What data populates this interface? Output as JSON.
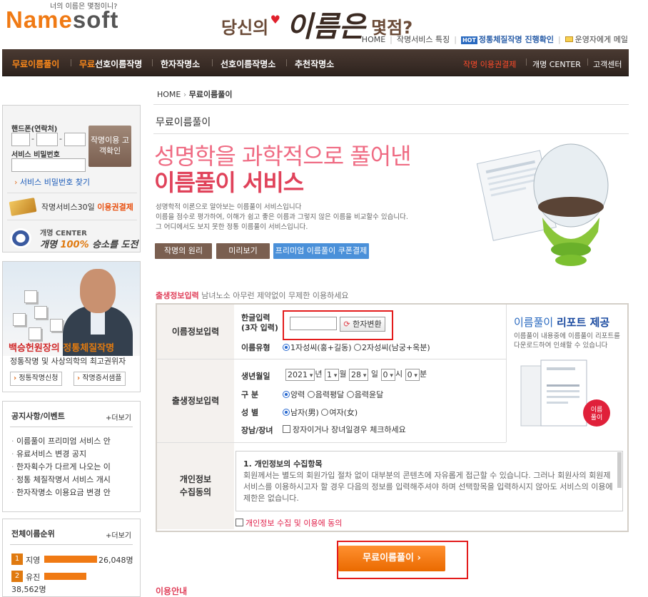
{
  "header": {
    "logo_text_1": "Name",
    "logo_text_2": "soft",
    "tagline": "너의 이름은 몇점이니?",
    "slogan_pre": "당신의",
    "slogan_big": "이름은",
    "slogan_post": "몇점?",
    "links": [
      {
        "label": "HOME"
      },
      {
        "label": "작명서비스 특징"
      },
      {
        "label": "정통체질작명 진행확인",
        "badge": "HOT"
      },
      {
        "label": "운영자에게 메일"
      }
    ]
  },
  "nav": {
    "items": [
      {
        "label": "무료이름풀이"
      },
      {
        "label": "무료선호이름작명"
      },
      {
        "label": "한자작명소"
      },
      {
        "label": "선호이름작명소"
      },
      {
        "label": "추천작명소"
      }
    ],
    "right": [
      {
        "label": "작명 이용권결제"
      },
      {
        "label": "개명 CENTER"
      },
      {
        "label": "고객센터"
      }
    ]
  },
  "login": {
    "phone_label": "핸드폰(연락처)",
    "pw_label": "서비스 비밀번호",
    "confirm_label": "작명이용 고객확인",
    "find_pw": "서비스 비밀번호 찾기",
    "pay30_pre": "작명서비스30일",
    "pay30_em": "이용권결제",
    "center_t1": "개명 CENTER",
    "center_t2_pre": "개명",
    "center_t2_em": "100%",
    "center_t2_post": "승소를 도전"
  },
  "promo": {
    "title_pre": "백승헌원장의",
    "title_em": "정통체질작명",
    "subtitle": "정통작명 및 사상의학의 최고권위자",
    "btn1": "정통작명신청",
    "btn2": "작명증서샘플"
  },
  "notice": {
    "title": "공지사항/이벤트",
    "more": "+더보기",
    "items": [
      "이름풀이 프리미엄 서비스 안",
      "유료서비스 변경 공지",
      "한자획수가 다르게 나오는 이",
      "정통 체질작명서 서비스 개시",
      "한자작명소 이용요금 변경 안"
    ]
  },
  "rank": {
    "title": "전체이름순위",
    "more": "+더보기",
    "items": [
      {
        "rank": "1",
        "name": "지영",
        "count": "26,048명",
        "ratio": 1.0
      },
      {
        "rank": "2",
        "name": "유진",
        "count": "38,562명",
        "ratio": 0.8
      }
    ]
  },
  "content": {
    "breadcrumb_home": "HOME",
    "breadcrumb_current": "무료이름풀이",
    "section_title": "무료이름풀이",
    "hero_line1": "성명학을 과학적으로 풀어낸",
    "hero_line2": "이름풀이 서비스",
    "desc": [
      "성명학적 이론으로 알아보는 이름풀이 서비스입니다",
      "이름을 점수로 평가하여, 이해가 쉽고 좋은 이름과 그렇지 않은 이름을 비교할수 있습니다.",
      "그 어디에서도 보지 못한 정통 이름풀이 서비스입니다."
    ],
    "buttons": [
      "작명의 원리",
      "미리보기",
      "프리미엄 이름풀이 쿠폰결제"
    ],
    "form_head_title": "출생정보입력",
    "form_head_sub": "남녀노소 아무런 제약없이 무제한 이용하세요"
  },
  "form": {
    "row1_label": "이름정보입력",
    "row2_label": "출생정보입력",
    "row3_label_1": "개인정보",
    "row3_label_2": "수집동의",
    "hangul_label_1": "한글입력",
    "hangul_label_2": "(3자 입력)",
    "hangul_value": "",
    "hanja_btn": "한자변환",
    "name_type_label": "이름유형",
    "name_type_opt1": "1자성씨(홍+길동)",
    "name_type_opt2": "2자성씨(남궁+옥분)",
    "birth_label": "생년월일",
    "year": "2021",
    "year_unit": "년",
    "month": "1",
    "month_unit": "월",
    "day": "28",
    "day_unit": "일",
    "hour": "0",
    "hour_unit": "시",
    "minute": "0",
    "minute_unit": "분",
    "calendar_label": "구 분",
    "cal_opt1": "양력",
    "cal_opt2": "음력평달",
    "cal_opt3": "음력윤달",
    "gender_label": "성 별",
    "gender_opt1": "남자(男)",
    "gender_opt2": "여자(女)",
    "eldest_label": "장남/장녀",
    "eldest_text": "장자이거나 장녀일경우 체크하세요",
    "report_title_pre": "이름풀이",
    "report_title_em": "리포트 제공",
    "report_desc_1": "이름풀이 내용중에 이름풀이 리포트를",
    "report_desc_2": "다운로드하여 인쇄할 수 있습니다",
    "consent_heading": "1. 개인정보의 수집항목",
    "consent_body": "회원께서는 별도의 회원가입 절차 없이 대부분의 콘텐츠에 자유롭게 접근할 수 있습니다. 그러나 회원사의 회원제 서비스를 이용하시고자 할 경우 다음의 정보를 입력해주셔야 하며 선택항목을 입력하시지 않아도 서비스의 이용에 제한은 없습니다.",
    "consent_check": "개인정보 수집 및 이용에 동의",
    "submit": "무료이름풀이"
  },
  "footer": {
    "next_title": "이용안내"
  },
  "colors": {
    "accent": "#f07a14",
    "nav_bg": "#3a2e28",
    "hero_pink": "#ef6b83",
    "highlight_red": "#e31b1b"
  }
}
